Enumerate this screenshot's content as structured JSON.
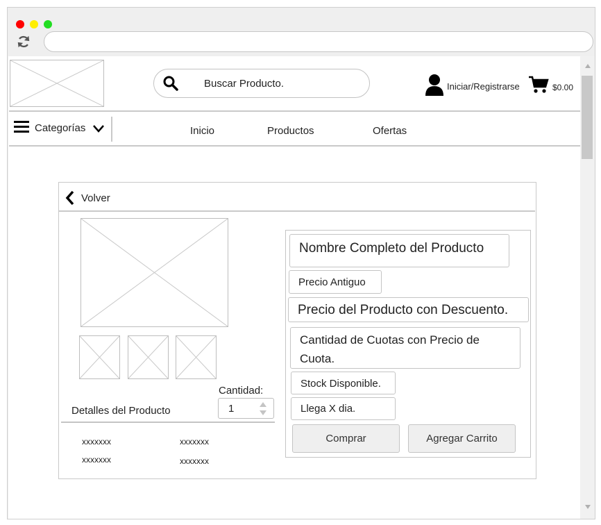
{
  "header": {
    "search_placeholder": "Buscar Producto.",
    "login_label": "Iniciar/Registrarse",
    "cart_total": "$0.00"
  },
  "nav": {
    "categories_label": "Categorías",
    "links": [
      "Inicio",
      "Productos",
      "Ofertas"
    ]
  },
  "product": {
    "back_label": "Volver",
    "name": "Nombre Completo del Producto",
    "old_price": "Precio Antiguo",
    "discount_price": "Precio del Producto con Descuento.",
    "installments": "Cantidad de Cuotas con Precio de Cuota.",
    "stock": "Stock Disponible.",
    "delivery": "Llega X dia.",
    "buy_label": "Comprar",
    "add_cart_label": "Agregar Carrito",
    "quantity_label": "Cantidad:",
    "quantity_value": "1",
    "details_title": "Detalles del Producto",
    "details": [
      [
        "xxxxxxx",
        "xxxxxxx"
      ],
      [
        "xxxxxxx",
        "xxxxxxx"
      ]
    ]
  },
  "colors": {
    "traffic_red": "#ff0000",
    "traffic_yellow": "#ffee00",
    "traffic_green": "#22dd22"
  },
  "icons": [
    "reload-icon",
    "search-icon",
    "user-icon",
    "cart-icon",
    "menu-icon",
    "chevron-down-icon",
    "chevron-left-icon"
  ]
}
